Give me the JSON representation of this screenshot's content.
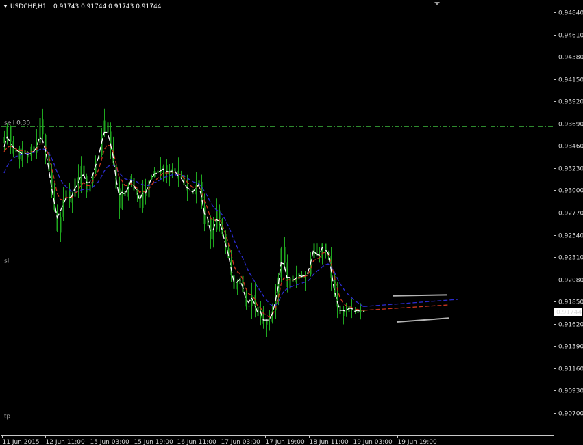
{
  "header": {
    "symbol_label": "USDCHF,H1",
    "ohlc": "0.91743 0.91744 0.91743 0.91744"
  },
  "colors": {
    "background": "#000000",
    "axis": "#c8c8c8",
    "bull": "#1fa81f",
    "bear": "#1fa81f",
    "ma_fast": "#ffffff",
    "ma_mid": "#c8361e",
    "ma_slow": "#2b2bd0",
    "sell_line": "#2e8b2e",
    "sl_line": "#c8361e",
    "tp_line": "#c8361e",
    "bid_line": "#8f9fb0",
    "triangle": "#b4b4b4"
  },
  "levels": {
    "sell": {
      "label": "sell 0.30",
      "value": 0.9366
    },
    "sl": {
      "label": "sl",
      "value": 0.9223
    },
    "tp": {
      "label": "tp",
      "value": 0.9063
    },
    "bid": {
      "value": 0.91744,
      "label": "0.91744"
    }
  },
  "chart_data": {
    "type": "candlestick",
    "symbol": "USDCHF",
    "timeframe": "H1",
    "ylim": [
      0.9063,
      0.9494
    ],
    "y_ticks": [
      "0.94840",
      "0.94610",
      "0.94380",
      "0.94150",
      "0.93920",
      "0.93690",
      "0.93460",
      "0.93230",
      "0.93000",
      "0.92770",
      "0.92540",
      "0.92310",
      "0.92080",
      "0.91850",
      "0.91620",
      "0.91390",
      "0.91160",
      "0.90930",
      "0.90700"
    ],
    "x_ticks": [
      "11 Jun 2015",
      "12 Jun 11:00",
      "15 Jun 03:00",
      "15 Jun 19:00",
      "16 Jun 11:00",
      "17 Jun 03:00",
      "17 Jun 19:00",
      "18 Jun 11:00",
      "19 Jun 03:00",
      "19 Jun 19:00"
    ],
    "close_path": [
      0.9355,
      0.9366,
      0.935,
      0.9338,
      0.9343,
      0.9332,
      0.9343,
      0.9337,
      0.9334,
      0.9345,
      0.934,
      0.935,
      0.9375,
      0.9358,
      0.934,
      0.932,
      0.9298,
      0.928,
      0.9258,
      0.9272,
      0.929,
      0.93,
      0.9288,
      0.9295,
      0.9312,
      0.9305,
      0.9325,
      0.9315,
      0.9298,
      0.9306,
      0.9318,
      0.933,
      0.9336,
      0.9358,
      0.9372,
      0.936,
      0.9345,
      0.9328,
      0.9302,
      0.9282,
      0.93,
      0.9294,
      0.9305,
      0.9315,
      0.93,
      0.9295,
      0.9282,
      0.93,
      0.9294,
      0.931,
      0.9315,
      0.932,
      0.9318,
      0.9322,
      0.9325,
      0.932,
      0.9318,
      0.9322,
      0.932,
      0.9312,
      0.9314,
      0.9306,
      0.93,
      0.93,
      0.9296,
      0.9305,
      0.931,
      0.9285,
      0.9265,
      0.927,
      0.925,
      0.926,
      0.928,
      0.927,
      0.9255,
      0.924,
      0.923,
      0.9212,
      0.9198,
      0.9205,
      0.921,
      0.9195,
      0.918,
      0.918,
      0.9192,
      0.918,
      0.917,
      0.9175,
      0.9162,
      0.9165,
      0.9165,
      0.9175,
      0.919,
      0.921,
      0.924,
      0.9225,
      0.92,
      0.921,
      0.9205,
      0.921,
      0.9214,
      0.921,
      0.9212,
      0.9215,
      0.923,
      0.9245,
      0.9232,
      0.9232,
      0.9245,
      0.9238,
      0.9232,
      0.921,
      0.919,
      0.918,
      0.9172,
      0.9176,
      0.9175,
      0.918,
      0.9178,
      0.9174,
      0.9176,
      0.9174,
      0.91744
    ],
    "bars": 123,
    "ma_fast": [
      0.9345,
      0.9355,
      0.935,
      0.9345,
      0.9342,
      0.934,
      0.9338,
      0.9338,
      0.9337,
      0.9338,
      0.934,
      0.9344,
      0.9355,
      0.9352,
      0.9342,
      0.9325,
      0.9305,
      0.9288,
      0.9272,
      0.9278,
      0.9285,
      0.9292,
      0.9292,
      0.9294,
      0.9302,
      0.9306,
      0.9315,
      0.9316,
      0.9308,
      0.9308,
      0.9315,
      0.9325,
      0.9334,
      0.9348,
      0.936,
      0.936,
      0.935,
      0.9335,
      0.9312,
      0.9295,
      0.9298,
      0.9296,
      0.9302,
      0.931,
      0.9305,
      0.93,
      0.929,
      0.9297,
      0.9297,
      0.9305,
      0.9312,
      0.9317,
      0.9318,
      0.932,
      0.9322,
      0.932,
      0.9319,
      0.932,
      0.932,
      0.9315,
      0.9313,
      0.9308,
      0.9303,
      0.9301,
      0.9298,
      0.9302,
      0.9306,
      0.9294,
      0.9276,
      0.9272,
      0.9258,
      0.9259,
      0.927,
      0.9268,
      0.9259,
      0.9246,
      0.9235,
      0.922,
      0.9205,
      0.9205,
      0.9208,
      0.92,
      0.9188,
      0.9184,
      0.9189,
      0.9183,
      0.9174,
      0.9175,
      0.9166,
      0.9166,
      0.9166,
      0.9172,
      0.9184,
      0.92,
      0.9225,
      0.9224,
      0.921,
      0.921,
      0.9207,
      0.9209,
      0.9212,
      0.9211,
      0.9212,
      0.9214,
      0.9224,
      0.9238,
      0.9234,
      0.9233,
      0.9241,
      0.9239,
      0.9235,
      0.9218,
      0.9198,
      0.9186,
      0.9176,
      0.9176,
      0.9175,
      0.9178,
      0.9178,
      0.9175,
      0.9176,
      0.9175,
      0.9175
    ],
    "ma_mid": [
      0.934,
      0.9344,
      0.9346,
      0.9344,
      0.9343,
      0.9341,
      0.9341,
      0.934,
      0.9339,
      0.934,
      0.934,
      0.9342,
      0.9348,
      0.9348,
      0.9345,
      0.9337,
      0.9325,
      0.9312,
      0.9297,
      0.9291,
      0.929,
      0.9293,
      0.9292,
      0.9293,
      0.9297,
      0.9299,
      0.9305,
      0.9308,
      0.9305,
      0.9305,
      0.9309,
      0.9315,
      0.9321,
      0.9331,
      0.9342,
      0.9347,
      0.9346,
      0.934,
      0.9328,
      0.9314,
      0.931,
      0.9305,
      0.9305,
      0.9307,
      0.9305,
      0.9303,
      0.9298,
      0.9299,
      0.9298,
      0.9301,
      0.9305,
      0.931,
      0.9312,
      0.9315,
      0.9318,
      0.9318,
      0.9318,
      0.9319,
      0.9319,
      0.9317,
      0.9316,
      0.9313,
      0.9309,
      0.9306,
      0.9303,
      0.9303,
      0.9305,
      0.9299,
      0.9289,
      0.9282,
      0.9272,
      0.9268,
      0.927,
      0.927,
      0.9265,
      0.9256,
      0.9247,
      0.9235,
      0.9222,
      0.9216,
      0.9214,
      0.9208,
      0.9199,
      0.9193,
      0.9192,
      0.9188,
      0.9181,
      0.9179,
      0.9173,
      0.9171,
      0.9169,
      0.9171,
      0.9177,
      0.9187,
      0.9203,
      0.921,
      0.9207,
      0.9208,
      0.9207,
      0.9208,
      0.921,
      0.921,
      0.9211,
      0.9212,
      0.9218,
      0.9227,
      0.9229,
      0.923,
      0.9235,
      0.9236,
      0.9235,
      0.9225,
      0.9212,
      0.92,
      0.9189,
      0.9184,
      0.9181,
      0.918,
      0.9179,
      0.9177,
      0.9177,
      0.9176,
      0.9176
    ],
    "ma_slow": [
      0.9318,
      0.9325,
      0.933,
      0.9333,
      0.9335,
      0.9336,
      0.9337,
      0.9338,
      0.9338,
      0.9339,
      0.9339,
      0.934,
      0.9342,
      0.9343,
      0.9342,
      0.9339,
      0.9334,
      0.9327,
      0.9319,
      0.9312,
      0.9307,
      0.9304,
      0.9301,
      0.9299,
      0.9299,
      0.9299,
      0.93,
      0.9301,
      0.9301,
      0.9301,
      0.9303,
      0.9306,
      0.9309,
      0.9314,
      0.932,
      0.9324,
      0.9326,
      0.9326,
      0.9323,
      0.9318,
      0.9315,
      0.9312,
      0.9311,
      0.9311,
      0.931,
      0.9309,
      0.9307,
      0.9306,
      0.9305,
      0.9305,
      0.9306,
      0.9308,
      0.9309,
      0.9311,
      0.9313,
      0.9314,
      0.9315,
      0.9316,
      0.9316,
      0.9316,
      0.9316,
      0.9315,
      0.9313,
      0.9311,
      0.9309,
      0.9308,
      0.9307,
      0.9304,
      0.9299,
      0.9294,
      0.9288,
      0.9283,
      0.928,
      0.9278,
      0.9275,
      0.927,
      0.9264,
      0.9257,
      0.9249,
      0.9242,
      0.9236,
      0.923,
      0.9223,
      0.9216,
      0.9211,
      0.9206,
      0.92,
      0.9196,
      0.9191,
      0.9187,
      0.9183,
      0.9181,
      0.9181,
      0.9184,
      0.9191,
      0.9196,
      0.9198,
      0.92,
      0.9201,
      0.9202,
      0.9203,
      0.9204,
      0.9205,
      0.9206,
      0.9209,
      0.9213,
      0.9216,
      0.9218,
      0.9221,
      0.9223,
      0.9224,
      0.9221,
      0.9216,
      0.921,
      0.9204,
      0.9199,
      0.9195,
      0.9192,
      0.9189,
      0.9186,
      0.9184,
      0.9182,
      0.918
    ]
  },
  "triangle_pattern": {
    "upper": [
      [
        0.9191,
        0.9192
      ]
    ],
    "lower": [
      [
        0.9164,
        0.9168
      ]
    ]
  }
}
